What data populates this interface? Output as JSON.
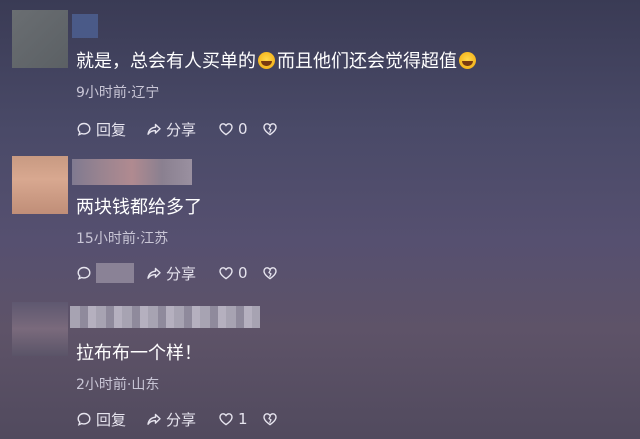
{
  "comments": [
    {
      "text_a": "就是，总会有人买单的",
      "text_b": "而且他们还会觉得超值",
      "meta": "9小时前·辽宁",
      "reply_label": "回复",
      "share_label": "分享",
      "likes": "0"
    },
    {
      "text": "两块钱都给多了",
      "meta": "15小时前·江苏",
      "share_label": "分享",
      "likes": "0"
    },
    {
      "text": "拉布布一个样！",
      "meta": "2小时前·山东",
      "reply_label": "回复",
      "share_label": "分享",
      "likes": "1"
    }
  ],
  "colors": {
    "text": "#ffffff",
    "meta": "#c9c6d6",
    "emoji": "#f5b51e"
  },
  "icons": [
    "reply-icon",
    "share-icon",
    "like-icon",
    "dislike-icon",
    "laugh-cry-emoji-icon"
  ]
}
